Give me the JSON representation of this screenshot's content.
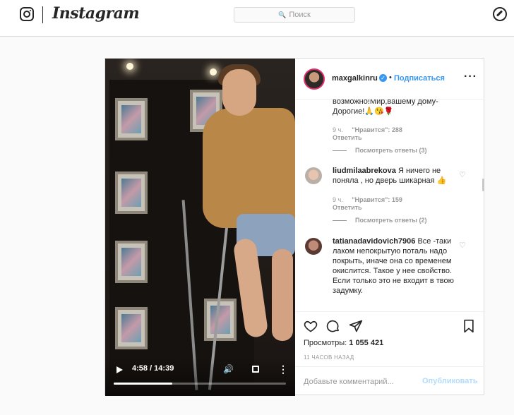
{
  "app": {
    "wordmark": "Instagram"
  },
  "search": {
    "placeholder": "Поиск"
  },
  "post": {
    "username": "maxgalkinru",
    "follow_label": "Подписаться",
    "video": {
      "time": "4:58 / 14:39",
      "progress": 0.34
    },
    "comments": [
      {
        "text": "возможно!Мир,вашему дому-Дорогие!🙏😘🌹",
        "time": "9 ч.",
        "likes": "\"Нравится\": 288",
        "reply": "Ответить",
        "view_replies": "Посмотреть ответы (3)"
      },
      {
        "user": "liudmilaabrekova",
        "text": "Я ничего не поняла , но дверь шикарная 👍",
        "time": "9 ч.",
        "likes": "\"Нравится\": 159",
        "reply": "Ответить",
        "view_replies": "Посмотреть ответы (2)"
      },
      {
        "user": "tatianadavidovich7906",
        "text": "Все -таки лаком непокрытую поталь надо покрыть, иначе она со временем окислится. Такое у нее свойство. Если только это не входит в твою задумку."
      }
    ],
    "views_label": "Просмотры:",
    "views_count": "1 055 421",
    "posted_ago": "11 ЧАСОВ НАЗАД",
    "add_comment_placeholder": "Добавьте комментарий...",
    "publish_label": "Опубликовать"
  },
  "colors": {
    "accent": "#3897f0",
    "border": "#dbdbdb",
    "muted": "#999999"
  }
}
